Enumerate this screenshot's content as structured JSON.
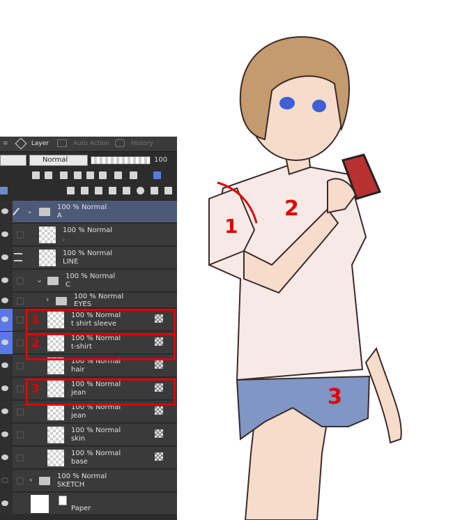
{
  "tabs": [
    {
      "label": "Layer",
      "active": true
    },
    {
      "label": "Auto Action",
      "active": false
    },
    {
      "label": "History",
      "active": false
    }
  ],
  "toolbar": {
    "blend_mode": "Normal",
    "opacity": "100"
  },
  "layers": [
    {
      "id": "A",
      "opacity": "100 % Normal",
      "name": "A",
      "kind": "folder",
      "selected": true
    },
    {
      "id": "dot",
      "opacity": "100 % Normal",
      "name": ".",
      "kind": "raster"
    },
    {
      "id": "line",
      "opacity": "100 % Normal",
      "name": "LINE",
      "kind": "raster"
    },
    {
      "id": "C",
      "opacity": "100 % Normal",
      "name": "C",
      "kind": "folder"
    },
    {
      "id": "eyes",
      "opacity": "100 % Normal",
      "name": "EYES",
      "kind": "folder"
    },
    {
      "id": "sleeve",
      "opacity": "100 % Normal",
      "name": "t shirt sleeve",
      "kind": "raster"
    },
    {
      "id": "tshirt",
      "opacity": "100 % Normal",
      "name": "t-shirt",
      "kind": "raster"
    },
    {
      "id": "hair",
      "opacity": "100 % Normal",
      "name": "hair",
      "kind": "raster"
    },
    {
      "id": "jean1",
      "opacity": "100 % Normal",
      "name": "jean",
      "kind": "raster"
    },
    {
      "id": "jean2",
      "opacity": "100 % Normal",
      "name": "jean",
      "kind": "raster"
    },
    {
      "id": "skin",
      "opacity": "100 % Normal",
      "name": "skin",
      "kind": "raster"
    },
    {
      "id": "base",
      "opacity": "100 % Normal",
      "name": "base",
      "kind": "raster"
    },
    {
      "id": "sketch",
      "opacity": "100 % Normal",
      "name": "SKETCH",
      "kind": "folder"
    },
    {
      "id": "paper",
      "opacity": "",
      "name": "Paper",
      "kind": "paper"
    }
  ],
  "annotations": {
    "panel": [
      "1",
      "2",
      "3"
    ],
    "art": [
      "1",
      "2",
      "3"
    ]
  },
  "colors": {
    "highlight_red": "#e00000",
    "selected_blue": "#5a78e8",
    "folder_selected": "#4c5a78",
    "shirt": "#f7e9e6",
    "jeans": "#8096c4",
    "hair": "#c59a6c",
    "skin": "#f6dccb",
    "phone": "#b8302f"
  },
  "icons": [
    "eye-icon",
    "pen-icon",
    "folder-icon",
    "lock-icon",
    "trash-icon",
    "chevron-right-icon",
    "chevron-down-icon",
    "reference-layer-icon"
  ]
}
